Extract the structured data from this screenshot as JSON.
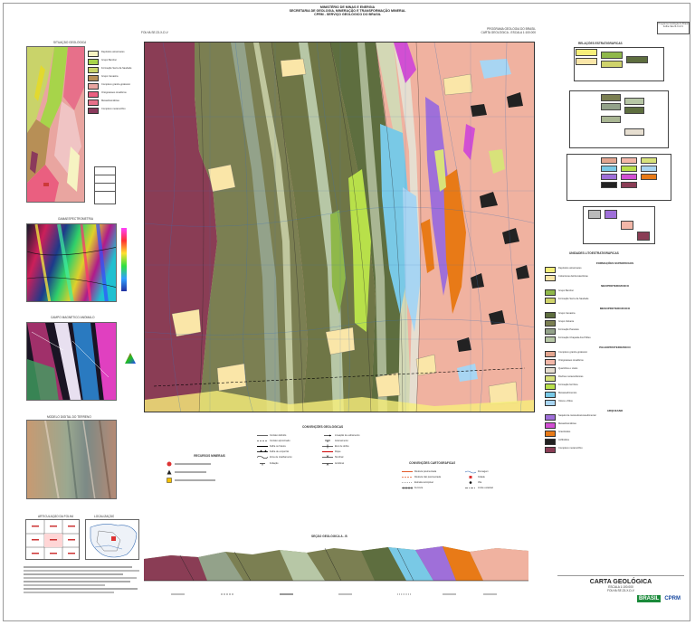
{
  "header": {
    "institution_lines": [
      "MINISTÉRIO DE MINAS E ENERGIA",
      "SECRETARIA DE GEOLOGIA, MINERAÇÃO E TRANSFORMAÇÃO MINERAL",
      "CPRM - SERVIÇO GEOLÓGICO DO BRASIL"
    ],
    "left_caption": "FOLHA SE.23-X-D-V",
    "right_caption_lines": [
      "PROGRAMA GEOLOGIA DO BRASIL",
      "CARTA GEOLÓGICA - ESCALA 1:100.000"
    ],
    "stamp_lines": [
      "Programa Geologia do Brasil",
      "Folha SE.23-X-D-V"
    ]
  },
  "insets": {
    "geology_title": "SITUAÇÃO GEOLÓGICA",
    "gamma_title": "GAMAESPECTROMETRIA",
    "magnetic_title": "CAMPO MAGNÉTICO ANÔMALO",
    "relief_title": "MODELO DIGITAL DO TERRENO",
    "location_title": "LOCALIZAÇÃO",
    "index_title": "ARTICULAÇÃO DA FOLHA"
  },
  "symbols_title": "CONVENÇÕES GEOLÓGICAS",
  "symbols_title2": "CONVENÇÕES CARTOGRÁFICAS",
  "resources_title": "RECURSOS MINERAIS",
  "section_title": "SEÇÃO GEOLÓGICA  A - B",
  "stratigraphy_title": "RELAÇÕES ESTRATIGRÁFICAS",
  "legend_title": "UNIDADES LITOESTRATIGRÁFICAS",
  "legend_groups": [
    {
      "heading": "FORMAÇÕES SUPERFICIAIS",
      "items": [
        {
          "color": "#f7ef7a",
          "text": "Depósitos aluvionares"
        },
        {
          "color": "#fae6a8",
          "text": "Coberturas detrito-lateríticas"
        }
      ]
    },
    {
      "heading": "NEOPROTEROZOICO",
      "items": [
        {
          "color": "#8fb84a",
          "text": "Grupo Bambuí"
        },
        {
          "color": "#cfd36b",
          "text": "Formação Serra da Saudade"
        }
      ]
    },
    {
      "heading": "MESOPROTEROZOICO",
      "items": [
        {
          "color": "#5e6e3f",
          "text": "Grupo Canastra"
        },
        {
          "color": "#7b7f52",
          "text": "Grupo Vazante"
        },
        {
          "color": "#93a28a",
          "text": "Formação Paracatu"
        },
        {
          "color": "#b7c7a6",
          "text": "Formação Chapada dos Pilões"
        }
      ]
    },
    {
      "heading": "PALEOPROTEROZOICO",
      "items": [
        {
          "color": "#e3a58f",
          "text": "Complexo granito-gnáissico"
        },
        {
          "color": "#f3b7a8",
          "text": "Ortognaisses tonalíticos"
        },
        {
          "color": "#e6ded0",
          "text": "Quartzitos e xistos"
        },
        {
          "color": "#d8e27a",
          "text": "Rochas metavulcânicas"
        },
        {
          "color": "#b8e04a",
          "text": "Formação ferrífera"
        },
        {
          "color": "#79c9e6",
          "text": "Metassedimentos"
        },
        {
          "color": "#a8d5f2",
          "text": "Xistos e filitos"
        }
      ]
    },
    {
      "heading": "ARQUEANO",
      "items": [
        {
          "color": "#9f6fd9",
          "text": "Sequência metavulcanossedimentar"
        },
        {
          "color": "#d24fd3",
          "text": "Metaultramáficas"
        },
        {
          "color": "#e87a17",
          "text": "Granitoides"
        },
        {
          "color": "#222222",
          "text": "Anfibolitos"
        },
        {
          "color": "#8a3d55",
          "text": "Complexo metamórfico"
        }
      ]
    }
  ],
  "symbols": [
    "Contato definido",
    "Contato aproximado",
    "Falha ou fratura",
    "Falha de empurrão",
    "Zona de cisalhamento",
    "Foliação",
    "Lineação de estiramento",
    "Acamamento",
    "Eixo de dobra",
    "Dique",
    "Sinclinal",
    "Anticlinal"
  ],
  "symbols2": [
    "Rodovia pavimentada",
    "Rodovia não pavimentada",
    "Estrada carroçável",
    "Ferrovia",
    "Drenagem",
    "Cidade",
    "Vila",
    "Limite estadual"
  ],
  "title_block": {
    "title": "CARTA GEOLÓGICA",
    "scale": "ESCALA 1:100.000",
    "sheet": "FOLHA SE.23-X-D-V",
    "logo_brasil": "BRASIL",
    "logo_cprm": "CPRM"
  },
  "colors": {
    "frame": "#333333",
    "grid": "#3a6fb5"
  }
}
